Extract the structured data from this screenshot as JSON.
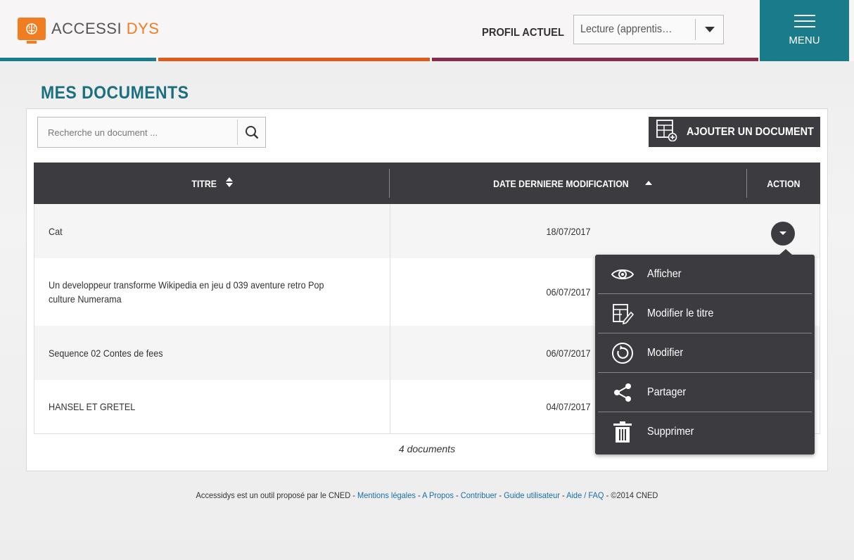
{
  "app": {
    "logo_a": "ACCESSI",
    "logo_b": "DYS"
  },
  "header": {
    "profil_label": "PROFIL ACTUEL",
    "profil_value": "Lecture (apprentis…",
    "menu_label": "MENU"
  },
  "colors": {
    "teal": "#1a7b8a",
    "orange": "#e05a1a",
    "purple": "#8a2a4a",
    "dark": "#3c3c40"
  },
  "main": {
    "title": "MES DOCUMENTS",
    "search_placeholder": "Recherche un document ...",
    "add_label": "AJOUTER UN DOCUMENT"
  },
  "table": {
    "headers": [
      "TITRE",
      "DATE DERNIERE MODIFICATION",
      "ACTION"
    ],
    "rows": [
      {
        "title": "Cat",
        "date": "18/07/2017"
      },
      {
        "title": "Un developpeur transforme Wikipedia en jeu d 039 aventure retro Pop culture Numerama",
        "date": "06/07/2017"
      },
      {
        "title": "Sequence 02 Contes de fees",
        "date": "06/07/2017"
      },
      {
        "title": "HANSEL ET GRETEL",
        "date": "04/07/2017"
      }
    ],
    "count": "4 documents"
  },
  "dropdown": {
    "items": [
      {
        "label": "Afficher",
        "icon": "eye-icon"
      },
      {
        "label": "Modifier le titre",
        "icon": "edit-title-icon"
      },
      {
        "label": "Modifier",
        "icon": "refresh-icon"
      },
      {
        "label": "Partager",
        "icon": "share-icon"
      },
      {
        "label": "Supprimer",
        "icon": "trash-icon"
      }
    ]
  },
  "footer": {
    "prefix": "Accessidys est un outil proposé par le CNED - ",
    "links": [
      "Mentions légales",
      "A Propos",
      "Contribuer",
      "Guide utilisateur",
      "Aide / FAQ"
    ],
    "sep": " - ",
    "suffix": " - ©2014 CNED"
  }
}
